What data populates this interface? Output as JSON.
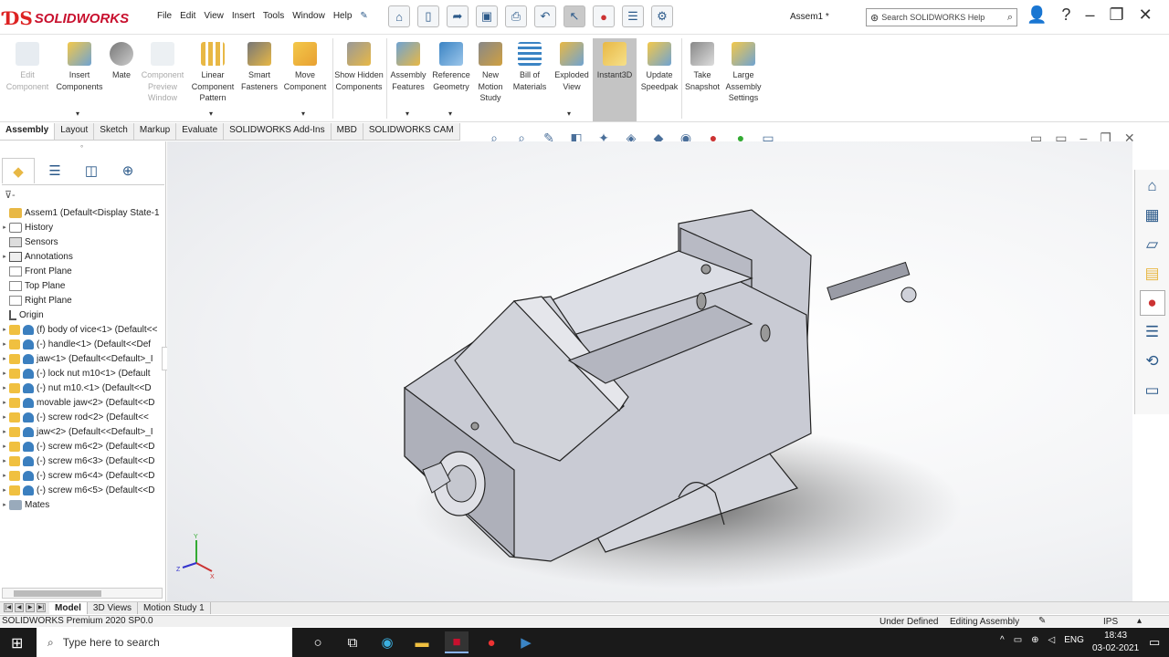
{
  "app": {
    "brand": "SOLIDWORKS",
    "document_title": "Assem1 *",
    "search_placeholder": "Search SOLIDWORKS Help"
  },
  "menu": [
    "File",
    "Edit",
    "View",
    "Insert",
    "Tools",
    "Window",
    "Help"
  ],
  "command_manager": [
    {
      "label": "Edit Component",
      "enabled": false
    },
    {
      "label": "Insert Components",
      "enabled": true
    },
    {
      "label": "Mate",
      "enabled": true
    },
    {
      "label": "Component Preview Window",
      "enabled": false
    },
    {
      "label": "Linear Component Pattern",
      "enabled": true
    },
    {
      "label": "Smart Fasteners",
      "enabled": true
    },
    {
      "label": "Move Component",
      "enabled": true
    },
    {
      "label": "Show Hidden Components",
      "enabled": true
    },
    {
      "label": "Assembly Features",
      "enabled": true
    },
    {
      "label": "Reference Geometry",
      "enabled": true
    },
    {
      "label": "New Motion Study",
      "enabled": true
    },
    {
      "label": "Bill of Materials",
      "enabled": true
    },
    {
      "label": "Exploded View",
      "enabled": true
    },
    {
      "label": "Instant3D",
      "enabled": true,
      "active": true
    },
    {
      "label": "Update Speedpak",
      "enabled": true
    },
    {
      "label": "Take Snapshot",
      "enabled": true
    },
    {
      "label": "Large Assembly Settings",
      "enabled": true
    }
  ],
  "tabs": [
    "Assembly",
    "Layout",
    "Sketch",
    "Markup",
    "Evaluate",
    "SOLIDWORKS Add-Ins",
    "MBD",
    "SOLIDWORKS CAM"
  ],
  "active_tab": "Assembly",
  "tree": [
    {
      "label": "Assem1  (Default<Display State-1",
      "icon": "assembly",
      "expand": false
    },
    {
      "label": "History",
      "icon": "history",
      "expand": true
    },
    {
      "label": "Sensors",
      "icon": "sensors",
      "expand": false
    },
    {
      "label": "Annotations",
      "icon": "annotations",
      "expand": true
    },
    {
      "label": "Front Plane",
      "icon": "plane",
      "expand": false
    },
    {
      "label": "Top Plane",
      "icon": "plane",
      "expand": false
    },
    {
      "label": "Right Plane",
      "icon": "plane",
      "expand": false
    },
    {
      "label": "Origin",
      "icon": "origin",
      "expand": false
    },
    {
      "label": "(f) body of vice<1> (Default<<",
      "icon": "part",
      "expand": true
    },
    {
      "label": "(-) handle<1> (Default<<Def",
      "icon": "part",
      "expand": true
    },
    {
      "label": "jaw<1> (Default<<Default>_I",
      "icon": "part",
      "expand": true
    },
    {
      "label": "(-) lock nut m10<1> (Default",
      "icon": "part",
      "expand": true
    },
    {
      "label": "(-) nut m10.<1> (Default<<D",
      "icon": "part",
      "expand": true
    },
    {
      "label": "movable jaw<2> (Default<<D",
      "icon": "part",
      "expand": true
    },
    {
      "label": "(-) screw rod<2> (Default<<",
      "icon": "part",
      "expand": true
    },
    {
      "label": "jaw<2> (Default<<Default>_I",
      "icon": "part",
      "expand": true
    },
    {
      "label": "(-) screw m6<2> (Default<<D",
      "icon": "part",
      "expand": true
    },
    {
      "label": "(-) screw m6<3> (Default<<D",
      "icon": "part",
      "expand": true
    },
    {
      "label": "(-) screw m6<4> (Default<<D",
      "icon": "part",
      "expand": true
    },
    {
      "label": "(-) screw m6<5> (Default<<D",
      "icon": "part",
      "expand": true
    },
    {
      "label": "Mates",
      "icon": "mates",
      "expand": true
    }
  ],
  "bottom_tabs": [
    "Model",
    "3D Views",
    "Motion Study 1"
  ],
  "status": {
    "product": "SOLIDWORKS Premium 2020 SP0.0",
    "state": "Under Defined",
    "mode": "Editing Assembly",
    "units": "IPS"
  },
  "taskbar": {
    "search_placeholder": "Type here to search",
    "lang": "ENG",
    "time": "18:43",
    "date": "03-02-2021"
  },
  "triad": {
    "x": "X",
    "y": "Y",
    "z": "Z"
  },
  "colors": {
    "brand_red": "#c8102e",
    "active_button": "#c4c4c4",
    "accent_blue": "#3b84c4"
  }
}
